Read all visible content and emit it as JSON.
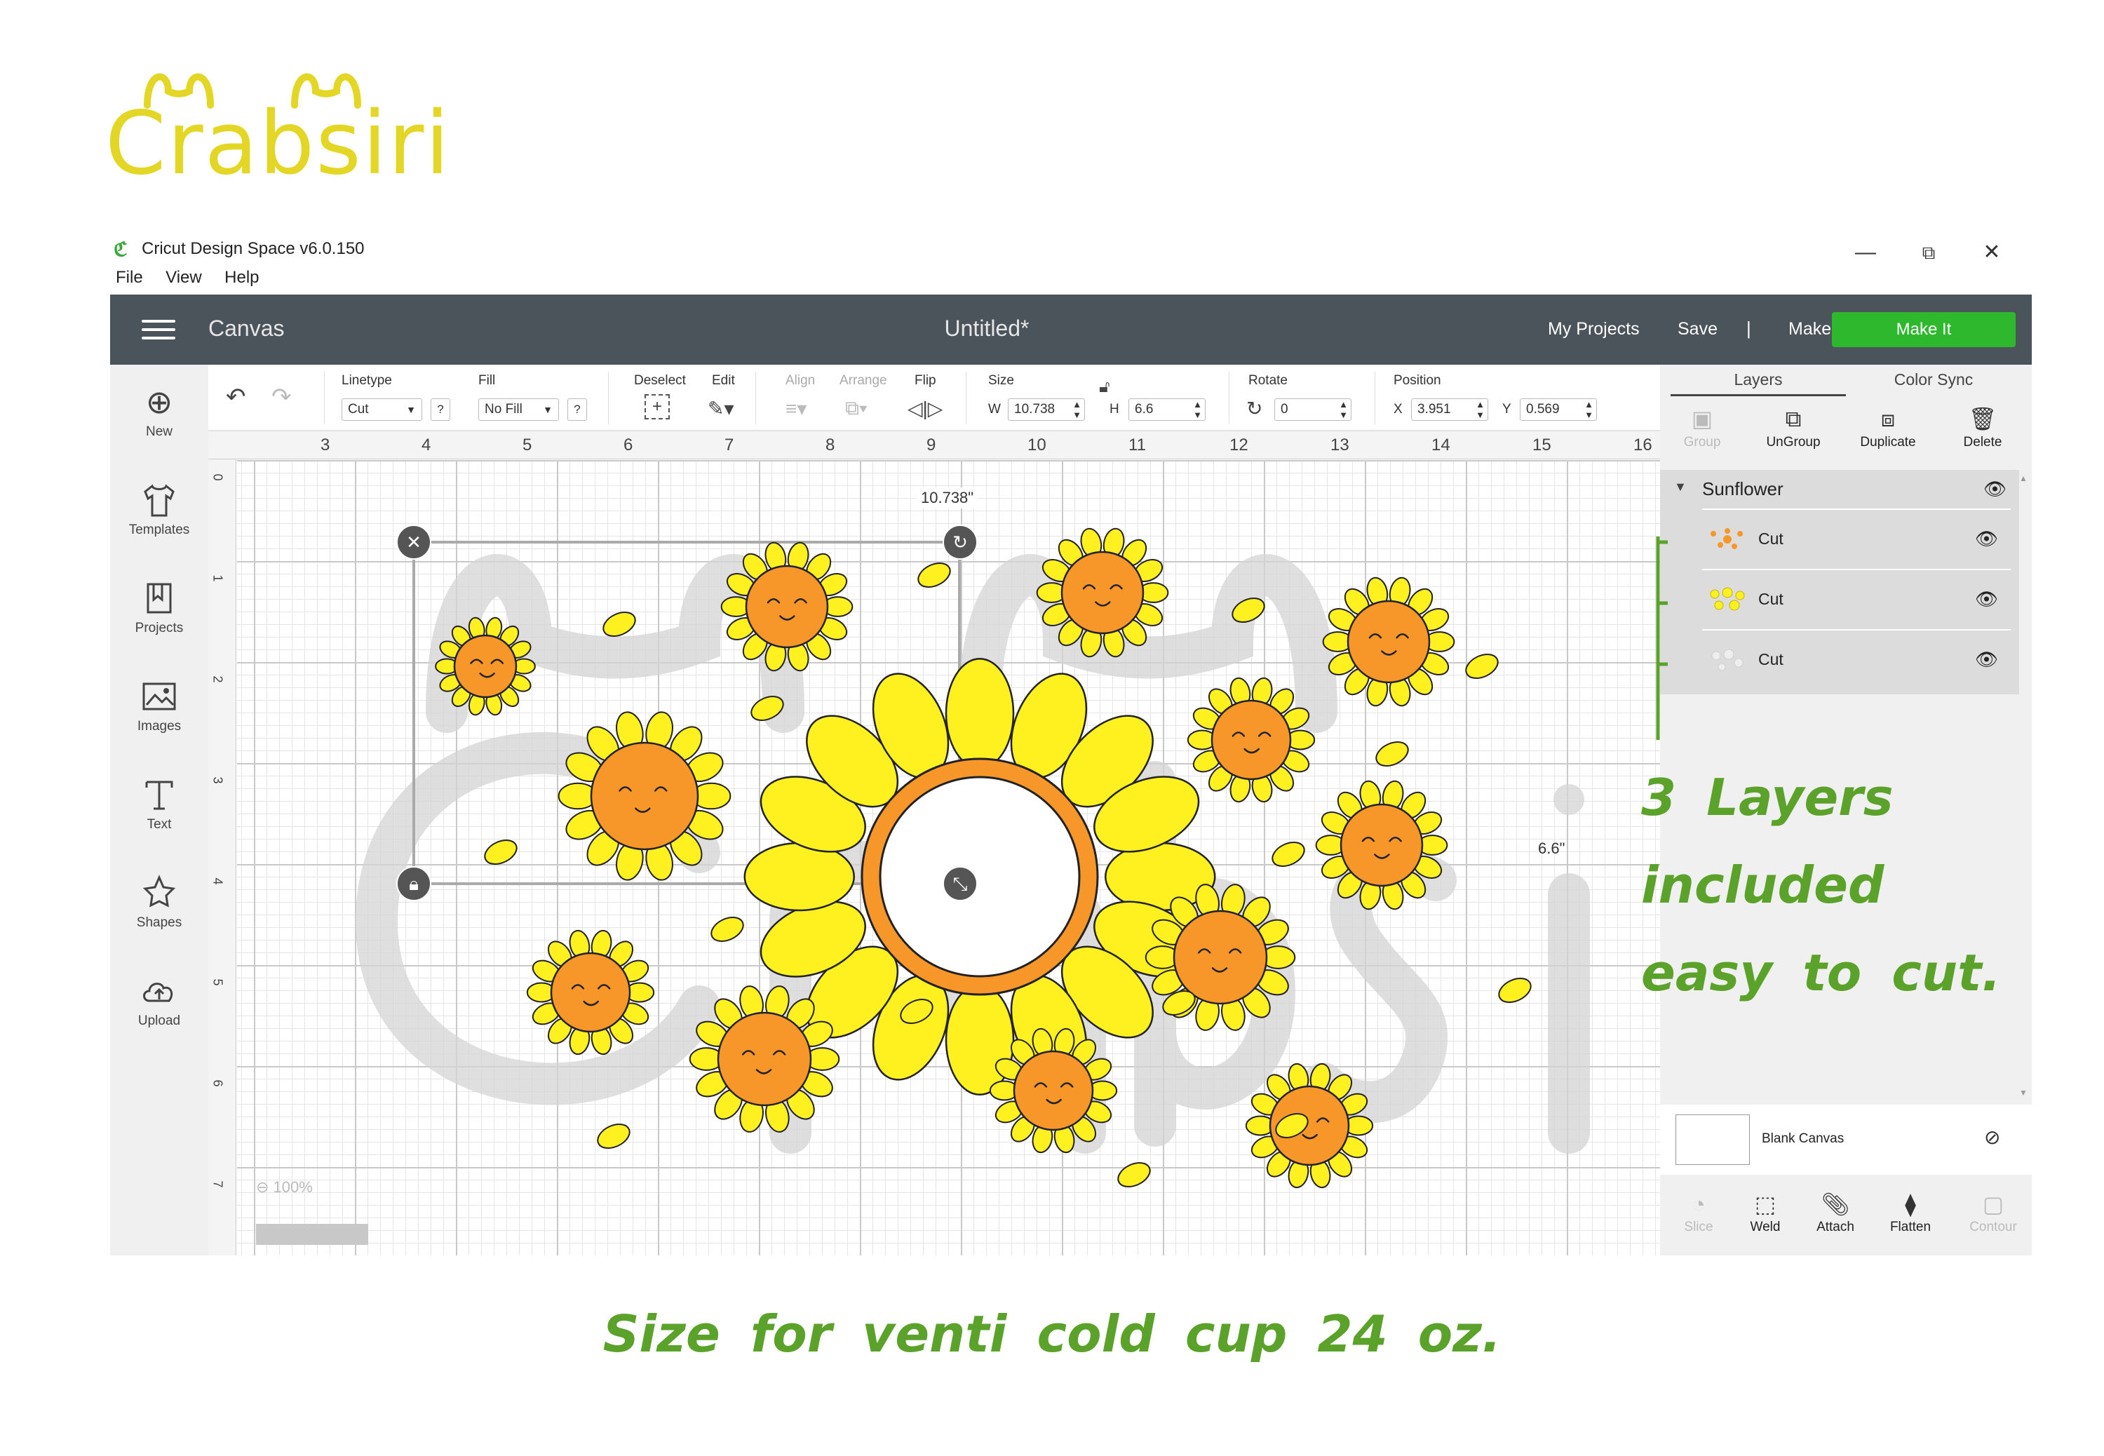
{
  "brand": {
    "name": "Crabsiri",
    "color": "#e3d624"
  },
  "window": {
    "title": "Cricut Design Space  v6.0.150",
    "minimize": "—",
    "restore": "⧉",
    "close": "✕",
    "menu": [
      "File",
      "View",
      "Help"
    ]
  },
  "header": {
    "canvas_label": "Canvas",
    "doc_title": "Untitled*",
    "my_projects": "My Projects",
    "save": "Save",
    "separator": "|",
    "machine": "Maker",
    "make_it": "Make It",
    "bg": "#4b535b",
    "make_it_color": "#2eb82e"
  },
  "left_tools": [
    {
      "label": "New",
      "icon": "plus-circle-icon"
    },
    {
      "label": "Templates",
      "icon": "tshirt-icon"
    },
    {
      "label": "Projects",
      "icon": "book-icon"
    },
    {
      "label": "Images",
      "icon": "image-icon"
    },
    {
      "label": "Text",
      "icon": "text-icon"
    },
    {
      "label": "Shapes",
      "icon": "shapes-icon"
    },
    {
      "label": "Upload",
      "icon": "cloud-upload-icon"
    }
  ],
  "editbar": {
    "linetype_label": "Linetype",
    "linetype_value": "Cut",
    "fill_label": "Fill",
    "fill_value": "No Fill",
    "help": "?",
    "deselect_label": "Deselect",
    "edit_label": "Edit",
    "align_label": "Align",
    "arrange_label": "Arrange",
    "flip_label": "Flip",
    "size_label": "Size",
    "w_label": "W",
    "w_value": "10.738",
    "h_label": "H",
    "h_value": "6.6",
    "rotate_label": "Rotate",
    "rotate_value": "0",
    "position_label": "Position",
    "x_label": "X",
    "x_value": "3.951",
    "y_label": "Y",
    "y_value": "0.569"
  },
  "canvas": {
    "ruler_top": [
      "3",
      "4",
      "5",
      "6",
      "7",
      "8",
      "9",
      "10",
      "11",
      "12",
      "13",
      "14",
      "15",
      "16"
    ],
    "ruler_left": [
      "0",
      "1",
      "2",
      "3",
      "4",
      "5",
      "6",
      "7"
    ],
    "width_label": "10.738\"",
    "height_label": "6.6\"",
    "zoom": "100%",
    "petal_color": "#fff01f",
    "center_color": "#f7972a"
  },
  "right_panel": {
    "tabs": [
      "Layers",
      "Color Sync"
    ],
    "actions": [
      {
        "label": "Group",
        "icon": "group-icon",
        "enabled": false
      },
      {
        "label": "UnGroup",
        "icon": "ungroup-icon",
        "enabled": true
      },
      {
        "label": "Duplicate",
        "icon": "duplicate-icon",
        "enabled": true
      },
      {
        "label": "Delete",
        "icon": "trash-icon",
        "enabled": true
      }
    ],
    "group_name": "Sunflower",
    "layers": [
      {
        "name": "Cut"
      },
      {
        "name": "Cut"
      },
      {
        "name": "Cut"
      }
    ],
    "blank_canvas": "Blank Canvas",
    "bottom_actions": [
      {
        "label": "Slice",
        "icon": "slice-icon",
        "enabled": false
      },
      {
        "label": "Weld",
        "icon": "weld-icon",
        "enabled": true
      },
      {
        "label": "Attach",
        "icon": "paperclip-icon",
        "enabled": true
      },
      {
        "label": "Flatten",
        "icon": "flatten-icon",
        "enabled": true
      },
      {
        "label": "Contour",
        "icon": "contour-icon",
        "enabled": false
      }
    ]
  },
  "annotation": {
    "line1": "3 Layers included",
    "line2": "easy to cut.",
    "color": "#5aa22a"
  },
  "footer_note": "Size for venti cold cup 24 oz."
}
